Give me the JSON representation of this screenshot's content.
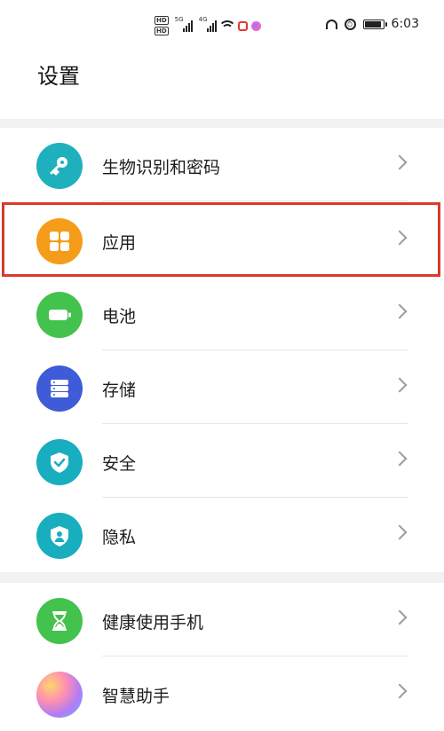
{
  "status_bar": {
    "time": "6:03",
    "signal1_label": "5G",
    "signal2_label": "4G",
    "hd1": "HD",
    "hd2": "HD",
    "icons": [
      "signal-icon",
      "signal-icon",
      "wifi-icon",
      "notification-icon",
      "app-icon",
      "headset-icon",
      "alarm-icon",
      "battery-icon"
    ],
    "battery_level": 0.85
  },
  "page": {
    "title": "设置"
  },
  "settings": {
    "items": [
      {
        "label": "生物识别和密码",
        "icon": "key-icon",
        "color": "#1fb0bd"
      },
      {
        "label": "应用",
        "icon": "apps-grid-icon",
        "color": "#f59c1a"
      },
      {
        "label": "电池",
        "icon": "battery-icon",
        "color": "#43c24d"
      },
      {
        "label": "存储",
        "icon": "storage-icon",
        "color": "#3f5bd8"
      },
      {
        "label": "安全",
        "icon": "shield-check-icon",
        "color": "#18aebf"
      },
      {
        "label": "隐私",
        "icon": "privacy-icon",
        "color": "#18aebf"
      },
      {
        "label": "健康使用手机",
        "icon": "hourglass-icon",
        "color": "#43c24d"
      },
      {
        "label": "智慧助手",
        "icon": "assistant-icon",
        "color": "#c47cf0"
      }
    ]
  },
  "highlight_color": "#d93a2b"
}
